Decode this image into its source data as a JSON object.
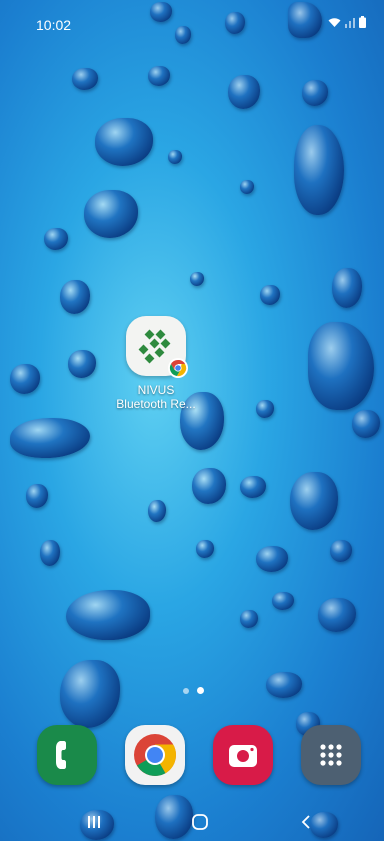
{
  "status_bar": {
    "time": "10:02",
    "icons": [
      "wifi-icon",
      "signal-icon",
      "battery-icon"
    ]
  },
  "home": {
    "apps": [
      {
        "label": "NIVUS Bluetooth Re...",
        "label_line1": "NIVUS",
        "label_line2": "Bluetooth Re...",
        "icon": "nivus-chrome-shortcut-icon"
      }
    ],
    "page_indicator": {
      "pages": 2,
      "current": 2
    }
  },
  "dock": {
    "items": [
      {
        "name": "phone",
        "icon": "phone-icon",
        "color": "#1a8a4a"
      },
      {
        "name": "chrome",
        "icon": "chrome-icon",
        "color": "#ffffff"
      },
      {
        "name": "camera",
        "icon": "camera-icon",
        "color": "#d81b48"
      },
      {
        "name": "apps",
        "icon": "apps-grid-icon",
        "color": "#4d6072"
      }
    ]
  },
  "navigation": {
    "buttons": [
      "recents-icon",
      "home-icon",
      "back-icon"
    ]
  },
  "colors": {
    "wallpaper_primary": "#2aa6e4",
    "wallpaper_light": "#5fd0f2",
    "text": "#ffffff"
  }
}
